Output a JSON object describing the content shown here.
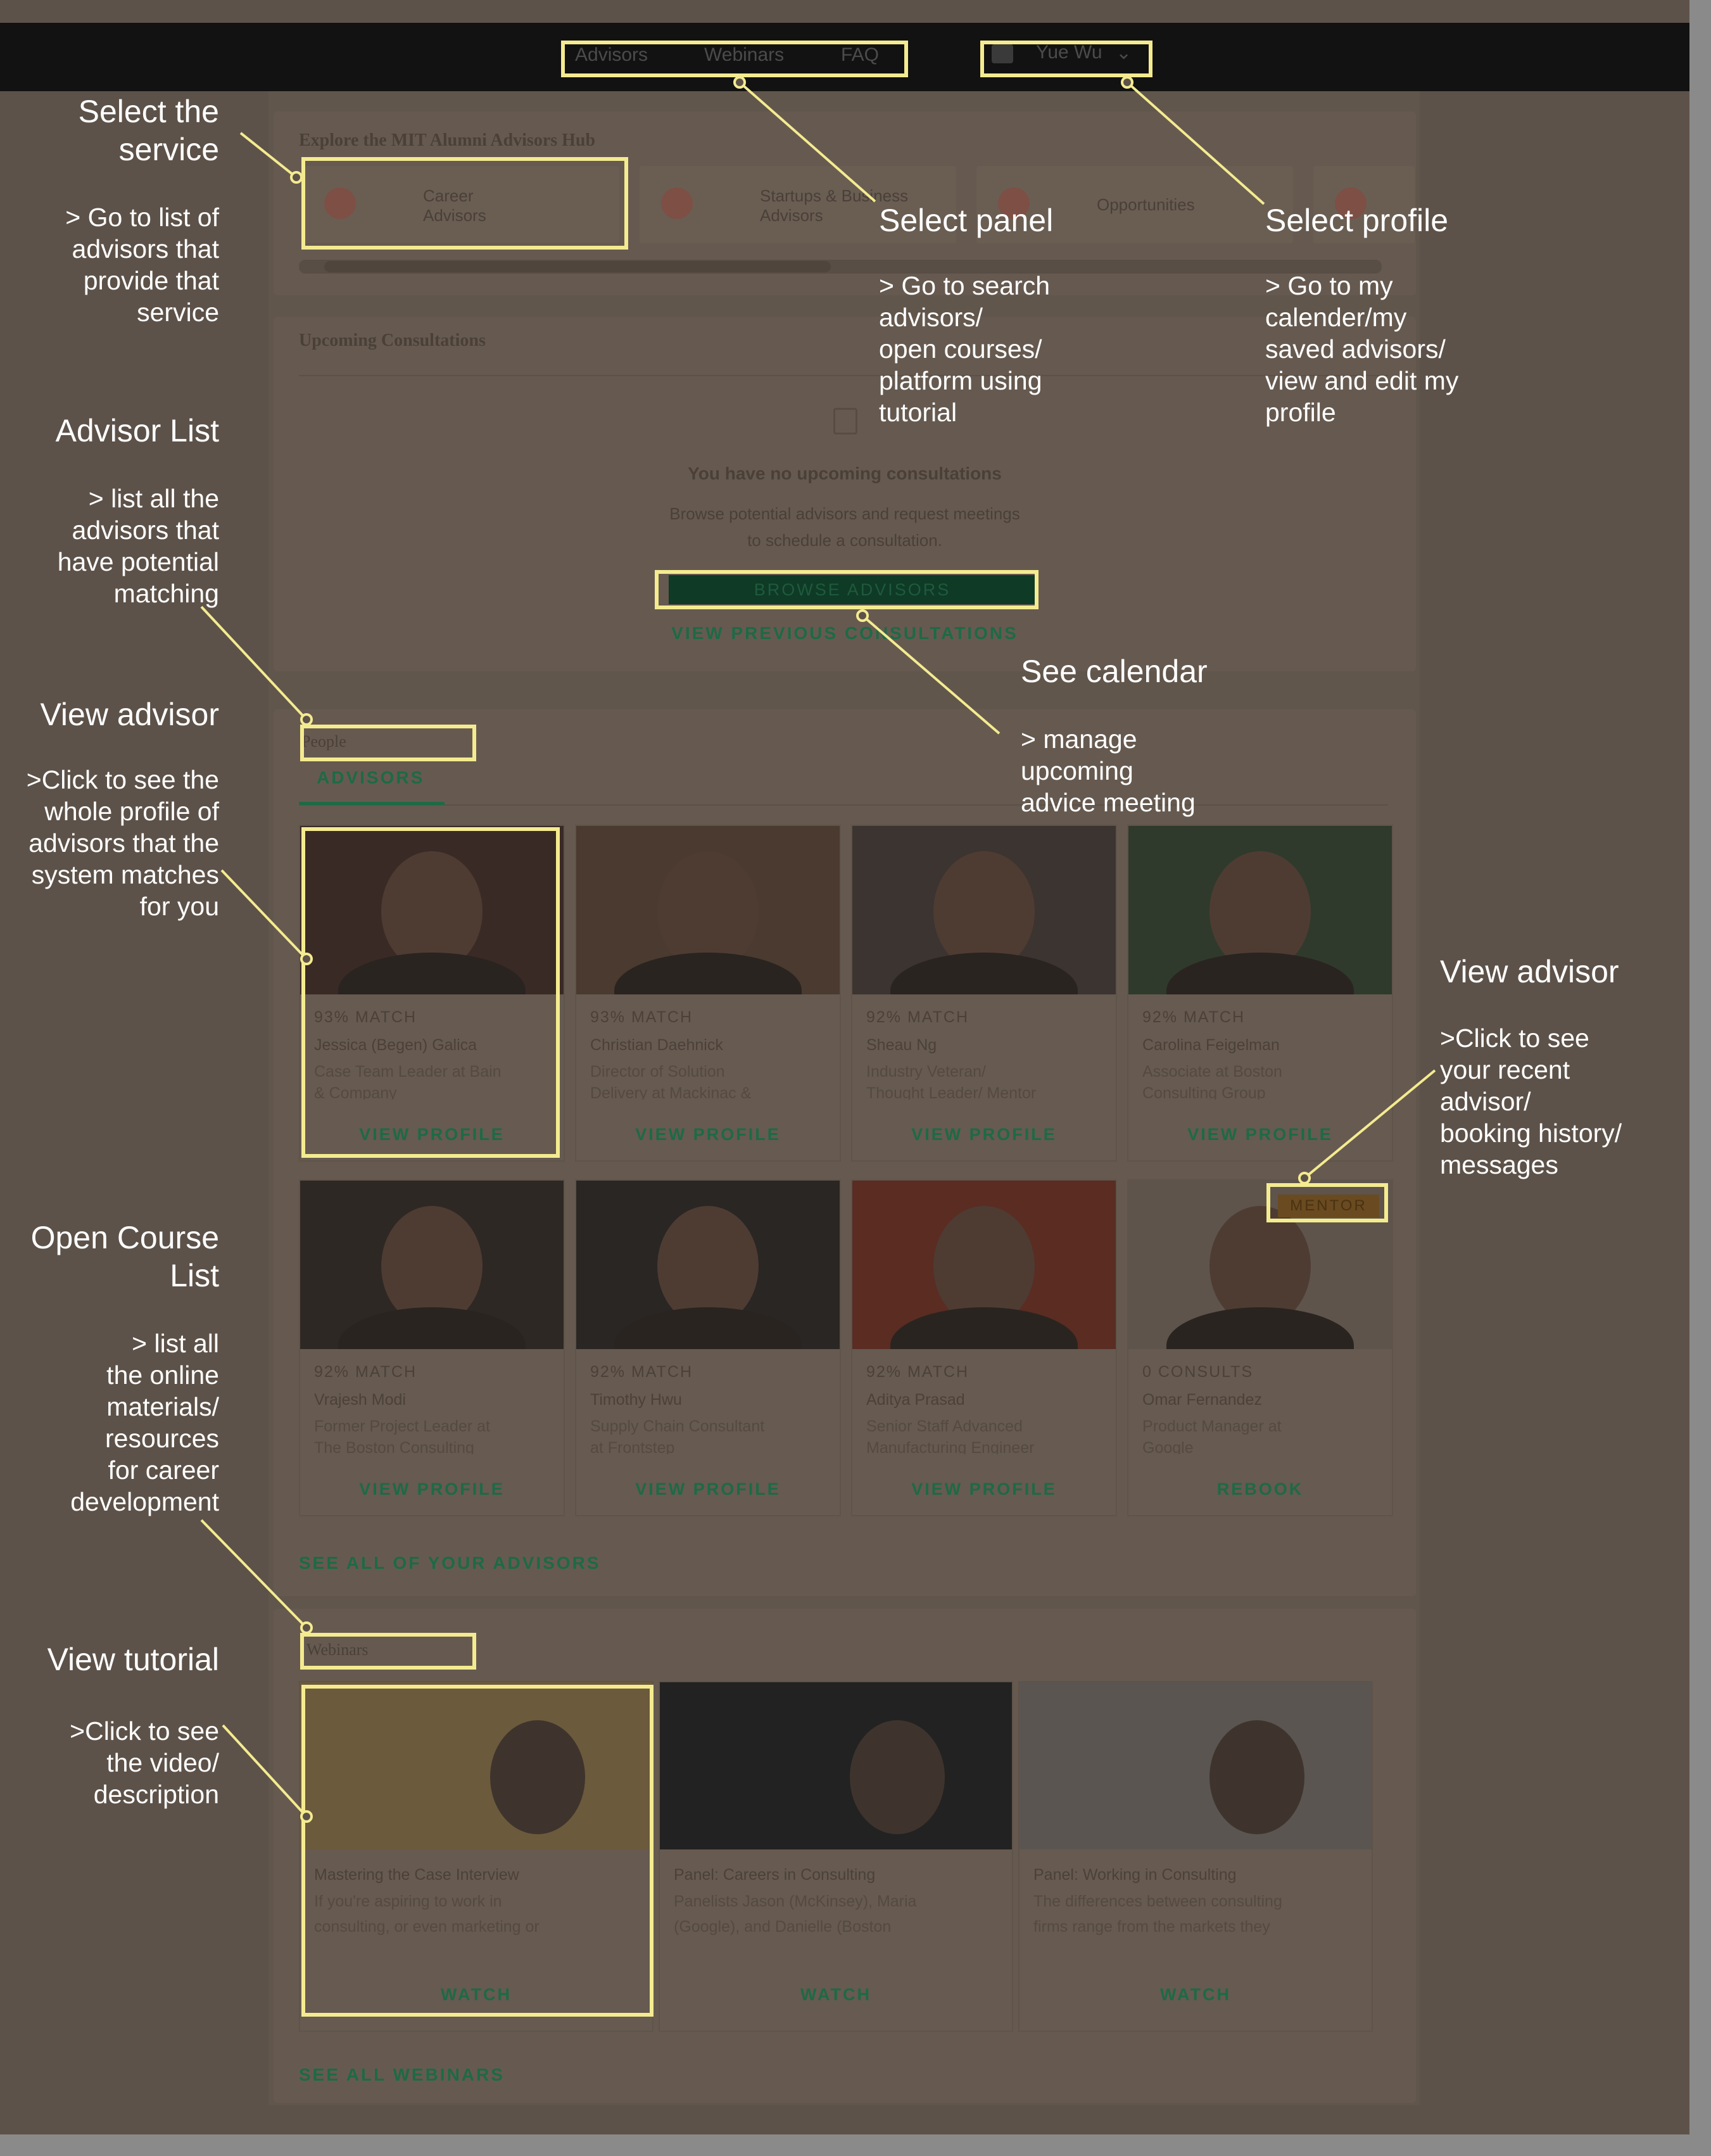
{
  "app": {
    "nav": [
      "Advisors",
      "Webinars",
      "FAQ"
    ],
    "user_name": "Yue Wu",
    "hub_title": "Explore the MIT Alumni Advisors Hub",
    "services": [
      "Career Advisors",
      "Startups & Business Advisors",
      "Opportunities"
    ],
    "upcoming": {
      "heading": "Upcoming Consultations",
      "empty_title": "You have no upcoming consultations",
      "empty_desc_1": "Browse potential advisors and request meetings",
      "empty_desc_2": "to schedule a consultation.",
      "browse_button": "BROWSE ADVISORS",
      "previous_link": "VIEW PREVIOUS CONSULTATIONS"
    },
    "people": {
      "heading": "People",
      "tab": "ADVISORS",
      "advisors": [
        {
          "match": "93% MATCH",
          "name": "Jessica (Begen) Galica",
          "role_1": "Case Team Leader at Bain",
          "role_2": "& Company",
          "action": "VIEW PROFILE",
          "tone": "#3a2a26"
        },
        {
          "match": "93% MATCH",
          "name": "Christian Daehnick",
          "role_1": "Director of Solution",
          "role_2": "Delivery at Mackinac &",
          "action": "VIEW PROFILE",
          "tone": "#4a3a2f"
        },
        {
          "match": "92% MATCH",
          "name": "Sheau Ng",
          "role_1": "Industry Veteran/",
          "role_2": "Thought Leader/ Mentor",
          "action": "VIEW PROFILE",
          "tone": "#3c3430"
        },
        {
          "match": "92% MATCH",
          "name": "Carolina Feigelman",
          "role_1": "Associate at Boston",
          "role_2": "Consulting Group",
          "action": "VIEW PROFILE",
          "tone": "#2f3a2c"
        },
        {
          "match": "92% MATCH",
          "name": "Vrajesh Modi",
          "role_1": "Former Project Leader at",
          "role_2": "The Boston Consulting",
          "action": "VIEW PROFILE",
          "tone": "#2e2824"
        },
        {
          "match": "92% MATCH",
          "name": "Timothy Hwu",
          "role_1": "Supply Chain Consultant",
          "role_2": "at Frontstep",
          "action": "VIEW PROFILE",
          "tone": "#292624"
        },
        {
          "match": "92% MATCH",
          "name": "Aditya Prasad",
          "role_1": "Senior Staff Advanced",
          "role_2": "Manufacturing Engineer",
          "action": "VIEW PROFILE",
          "tone": "#5a2c22"
        },
        {
          "match": "0 CONSULTS",
          "name": "Omar Fernandez",
          "role_1": "Product Manager at",
          "role_2": "Google",
          "action": "REBOOK",
          "tone": "#5e544c",
          "badge": "MENTOR"
        }
      ],
      "see_all": "SEE ALL OF YOUR ADVISORS"
    },
    "webinars": {
      "heading": "Webinars",
      "items": [
        {
          "title": "Mastering the Case Interview",
          "desc_1": "If you're aspiring to work in",
          "desc_2": "consulting, or even marketing or",
          "action": "WATCH",
          "tone": "#6b5a3c"
        },
        {
          "title": "Panel: Careers in Consulting",
          "desc_1": "Panelists Jason (McKinsey), Maria",
          "desc_2": "(Google), and Danielle (Boston",
          "action": "WATCH",
          "tone": "#222222"
        },
        {
          "title": "Panel: Working in Consulting",
          "desc_1": "The differences between consulting",
          "desc_2": "firms range from the markets they",
          "action": "WATCH",
          "tone": "#5a5550"
        }
      ],
      "see_all": "SEE ALL WEBINARS"
    }
  },
  "annotations": {
    "select_service": {
      "title": "Select the\nservice",
      "desc": "> Go to list of\nadvisors that\nprovide that\nservice"
    },
    "select_panel": {
      "title": "Select panel",
      "desc": "> Go to search\nadvisors/\nopen courses/\nplatform using\ntutorial"
    },
    "select_profile": {
      "title": "Select profile",
      "desc": "> Go to my\ncalender/my\nsaved advisors/\nview and edit my\nprofile"
    },
    "advisor_list": {
      "title": "Advisor List",
      "desc": "> list all the\nadvisors that\nhave potential\nmatching"
    },
    "see_calendar": {
      "title": "See calendar",
      "desc": "> manage\nupcoming\nadvice meeting"
    },
    "view_advisor_left": {
      "title": "View advisor",
      "desc": ">Click to see the\nwhole profile of\nadvisors that the\nsystem matches\nfor you"
    },
    "view_advisor_right": {
      "title": "View advisor",
      "desc": ">Click to see\nyour recent\nadvisor/\nbooking history/\nmessages"
    },
    "open_course": {
      "title": "Open Course\nList",
      "desc": "> list all\nthe online\nmaterials/\nresources\nfor career\ndevelopment"
    },
    "view_tutorial": {
      "title": "View tutorial",
      "desc": ">Click to see\nthe video/\ndescription"
    }
  },
  "colors": {
    "highlight": "#f4eb90",
    "overlay": "#5d5249",
    "accent_green": "#1d6a46"
  }
}
